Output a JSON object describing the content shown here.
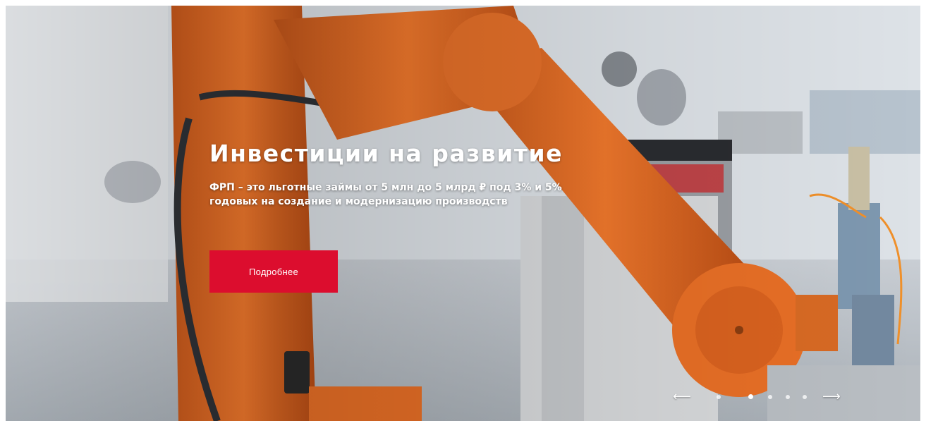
{
  "hero": {
    "title": "Инвестиции на развитие",
    "subtitle": "ФРП – это льготные займы от 5 млн до 5 млрд ₽ под 3% и 5% годовых на создание и модернизацию производств",
    "button_label": "Подробнее",
    "background_image": "industrial-robot-arm"
  },
  "slider": {
    "prev_icon": "arrow-left-icon",
    "next_icon": "arrow-right-icon",
    "slide_count": 5,
    "active_slide": 1
  },
  "colors": {
    "accent": "#dc0d2e",
    "text": "#ffffff"
  }
}
